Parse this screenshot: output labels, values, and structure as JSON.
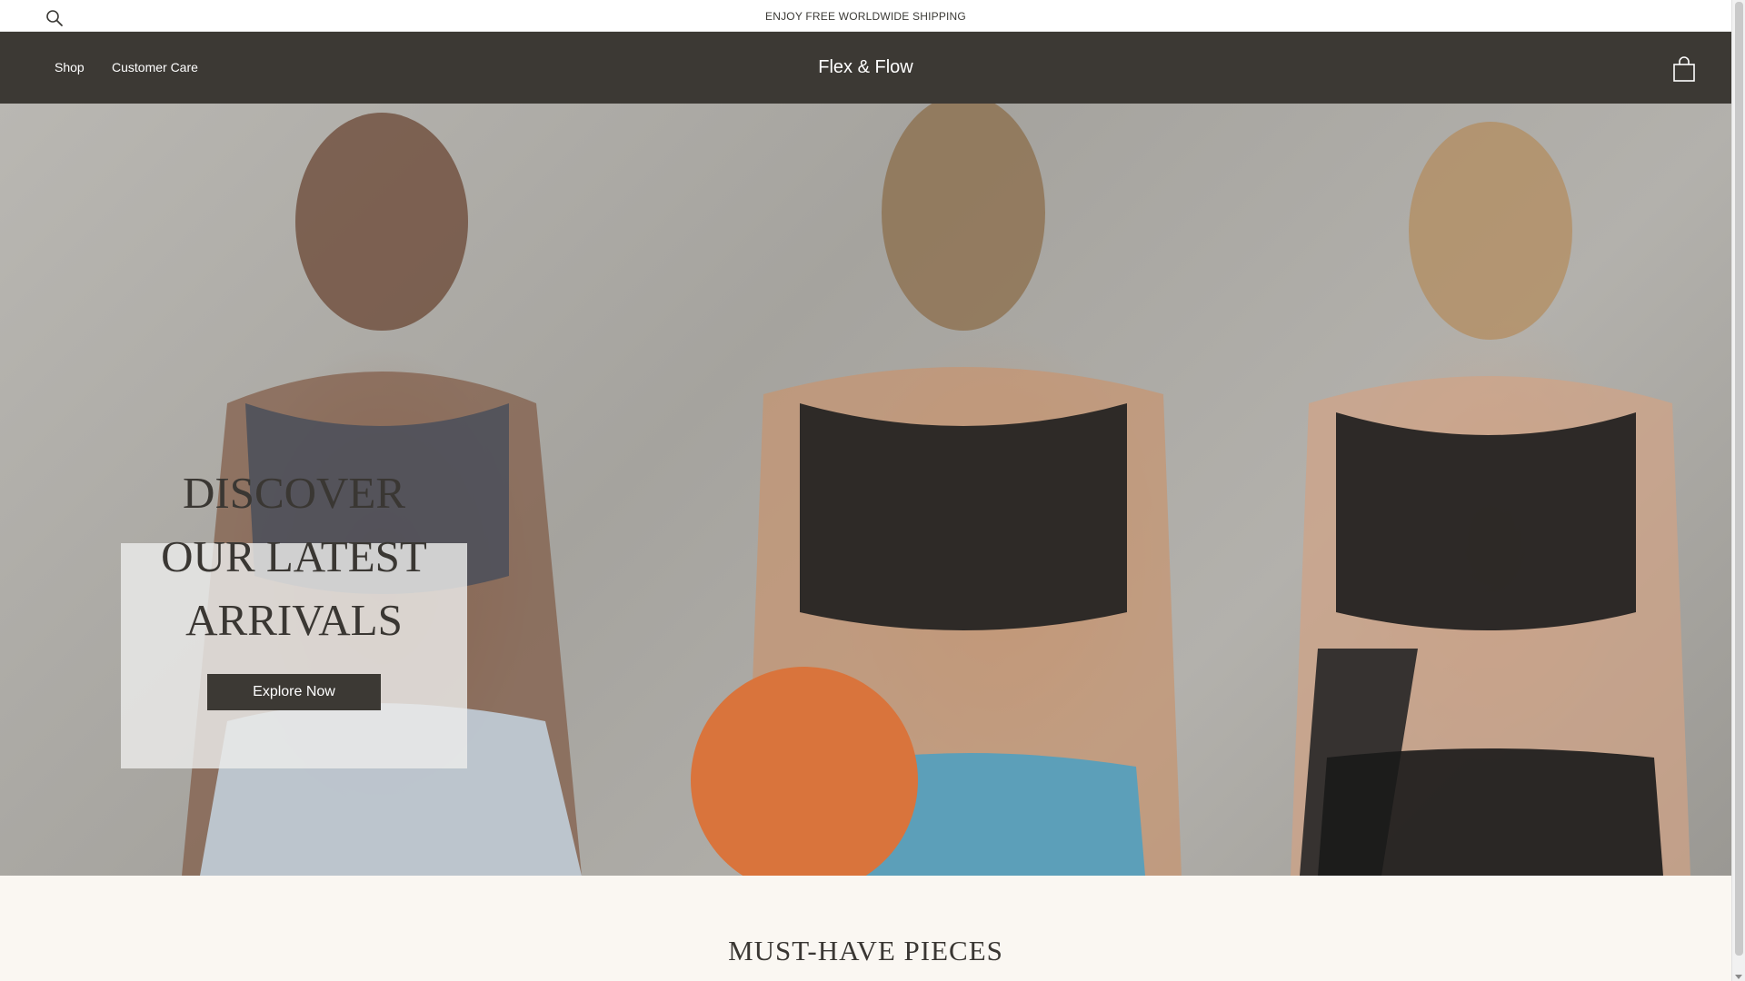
{
  "topbar": {
    "search_icon": "search-icon",
    "promo_text": "ENJOY FREE WORLDWIDE SHIPPING"
  },
  "header": {
    "nav": [
      {
        "label": "Shop"
      },
      {
        "label": "Customer Care"
      }
    ],
    "brand": "Flex & Flow",
    "cart_icon": "shopping-bag-icon"
  },
  "hero": {
    "image": "three-women-athletes-photo",
    "headline": [
      "DISCOVER",
      "OUR LATEST",
      "ARRIVALS"
    ],
    "cta_label": "Explore Now"
  },
  "section": {
    "title": "MUST-HAVE PIECES"
  },
  "colors": {
    "header_bg": "#3c3934",
    "text_dark": "#3a3733",
    "section_bg": "#faf7f2",
    "button_bg": "#3c3934"
  }
}
